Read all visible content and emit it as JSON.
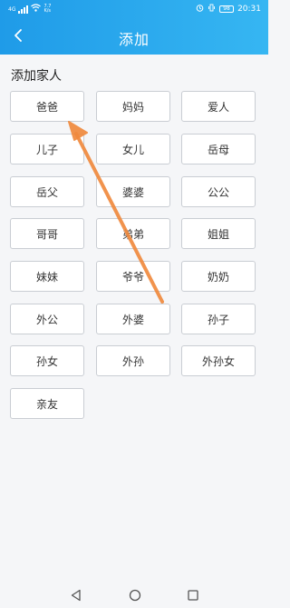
{
  "status": {
    "network_small": "4G",
    "speed_top": "7.7",
    "speed_bottom": "K/s",
    "battery": "98",
    "time": "20:31"
  },
  "header": {
    "title": "添加",
    "accent_color": "#1f9be8"
  },
  "section": {
    "title": "添加家人"
  },
  "relations": [
    "爸爸",
    "妈妈",
    "爱人",
    "儿子",
    "女儿",
    "岳母",
    "岳父",
    "婆婆",
    "公公",
    "哥哥",
    "弟弟",
    "姐姐",
    "妹妹",
    "爷爷",
    "奶奶",
    "外公",
    "外婆",
    "孙子",
    "孙女",
    "外孙",
    "外孙女",
    "亲友"
  ],
  "annotation": {
    "arrow_color": "#f08a3e"
  },
  "nav": {
    "icons": [
      "back-triangle-icon",
      "home-circle-icon",
      "recent-square-icon"
    ]
  }
}
